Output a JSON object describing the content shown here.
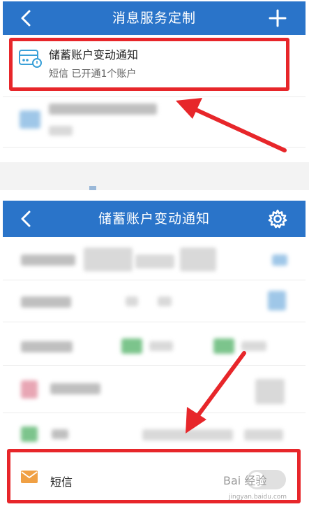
{
  "top_screen": {
    "title": "消息服务定制",
    "back_icon": "chevron-left-icon",
    "add_icon": "plus-icon",
    "account_card": {
      "name": "储蓄账户变动通知",
      "status": "短信 已开通1个账户",
      "icon": "card-icon"
    }
  },
  "bottom_screen": {
    "title": "储蓄账户变动通知",
    "back_icon": "chevron-left-icon",
    "settings_icon": "gear-icon",
    "sms_row": {
      "label": "短信",
      "icon": "envelope-icon",
      "toggle_on": false
    }
  },
  "watermark": {
    "text": "Bai 经验",
    "url_text": "jingyan.baidu.com"
  },
  "colors": {
    "navbar": "#2a74c9",
    "highlight_red": "#e7262a",
    "envelope_orange": "#f0a044"
  }
}
